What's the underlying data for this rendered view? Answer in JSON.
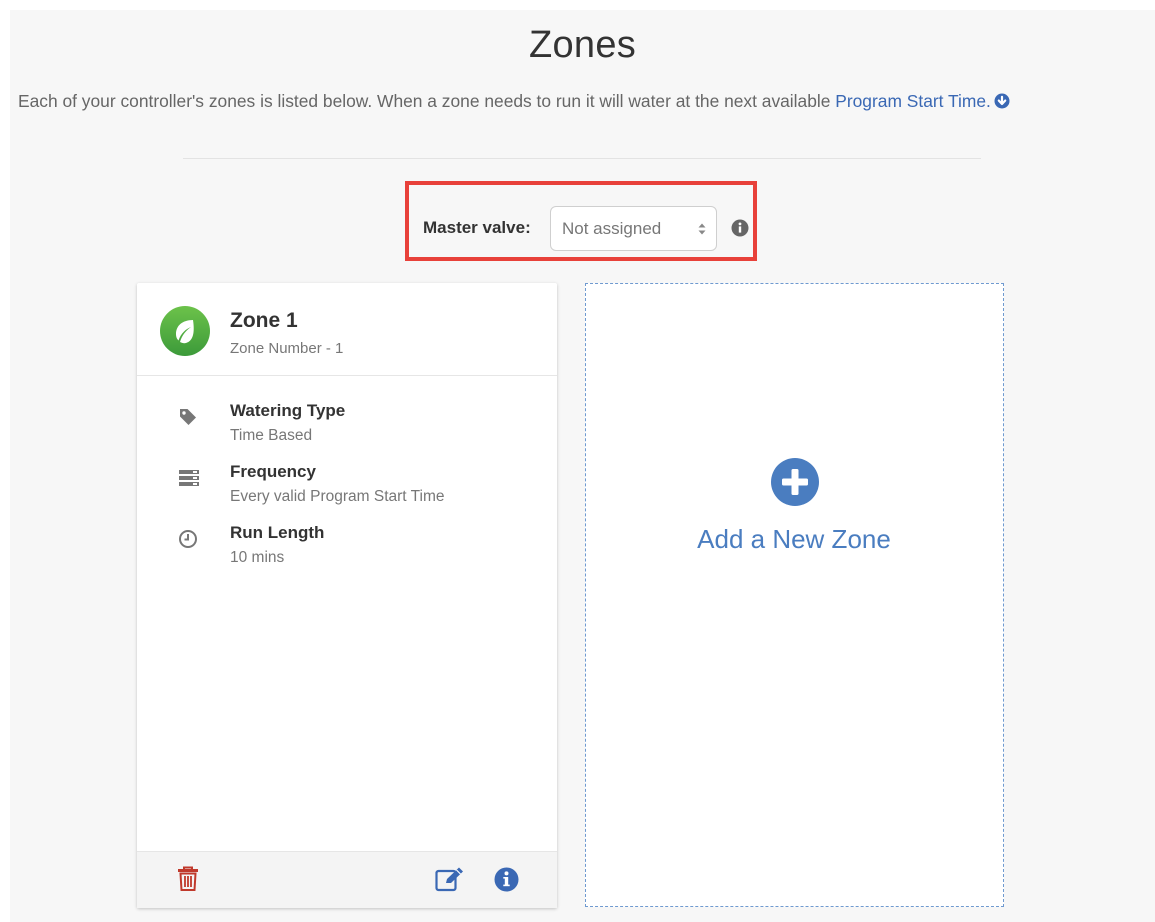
{
  "page": {
    "title": "Zones",
    "description": "Each of your controller's zones is listed below. When a zone needs to run it will water at the next available ",
    "description_link": "Program Start Time."
  },
  "master_valve": {
    "label": "Master valve:",
    "selected": "Not assigned"
  },
  "zone": {
    "name": "Zone 1",
    "number_text": "Zone Number - 1",
    "details": [
      {
        "title": "Watering Type",
        "value": "Time Based",
        "icon": "tag-icon"
      },
      {
        "title": "Frequency",
        "value": "Every valid Program Start Time",
        "icon": "list-icon"
      },
      {
        "title": "Run Length",
        "value": "10 mins",
        "icon": "clock-icon"
      }
    ]
  },
  "add_zone": {
    "label": "Add a New Zone"
  },
  "colors": {
    "accent_blue": "#3a68b4",
    "highlight_red": "#e8413a",
    "zone_green": "#4caf50",
    "delete_red": "#c0392b"
  }
}
